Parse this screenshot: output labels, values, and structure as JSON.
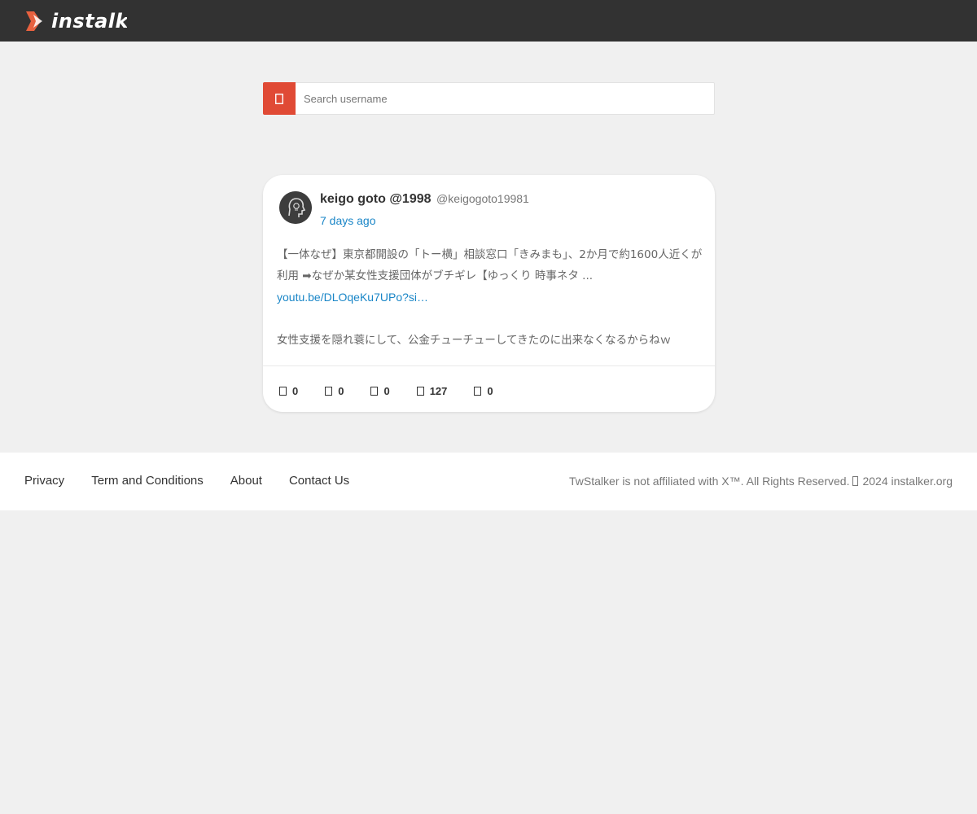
{
  "brand": {
    "name": "instalk",
    "logo_icon": "instalker-logo-icon",
    "logo_color": "#e8613f"
  },
  "search": {
    "placeholder": "Search username",
    "value": "",
    "button_icon": "search-icon",
    "button_color": "#e04a35"
  },
  "tweet": {
    "display_name": "keigo goto @1998",
    "handle": "@keigogoto19981",
    "time": "7 days ago",
    "text_line1": "【一体なぜ】東京都開設の「トー横」相談窓口「きみまも」、2か月で約1600人近くが利用 ➡なぜか某女性支援団体がブチギレ【ゆっくり 時事ネタ ...",
    "link": "youtu.be/DLOqeKu7UPo?si…",
    "text_line2": "女性支援を隠れ蓑にして、公金チューチューしてきたのに出来なくなるからねｗ",
    "stats": [
      {
        "icon": "reply-icon",
        "value": "0"
      },
      {
        "icon": "retweet-icon",
        "value": "0"
      },
      {
        "icon": "like-icon",
        "value": "0"
      },
      {
        "icon": "views-icon",
        "value": "127"
      },
      {
        "icon": "bookmark-icon",
        "value": "0"
      }
    ]
  },
  "footer": {
    "links": [
      "Privacy",
      "Term and Conditions",
      "About",
      "Contact Us"
    ],
    "copyright_prefix": "TwStalker is not affiliated with X™. All Rights Reserved.",
    "copyright_suffix": "2024 instalker.org"
  },
  "colors": {
    "navbar": "#323232",
    "page_background": "#f0f0f0",
    "link": "#1a86c7"
  }
}
